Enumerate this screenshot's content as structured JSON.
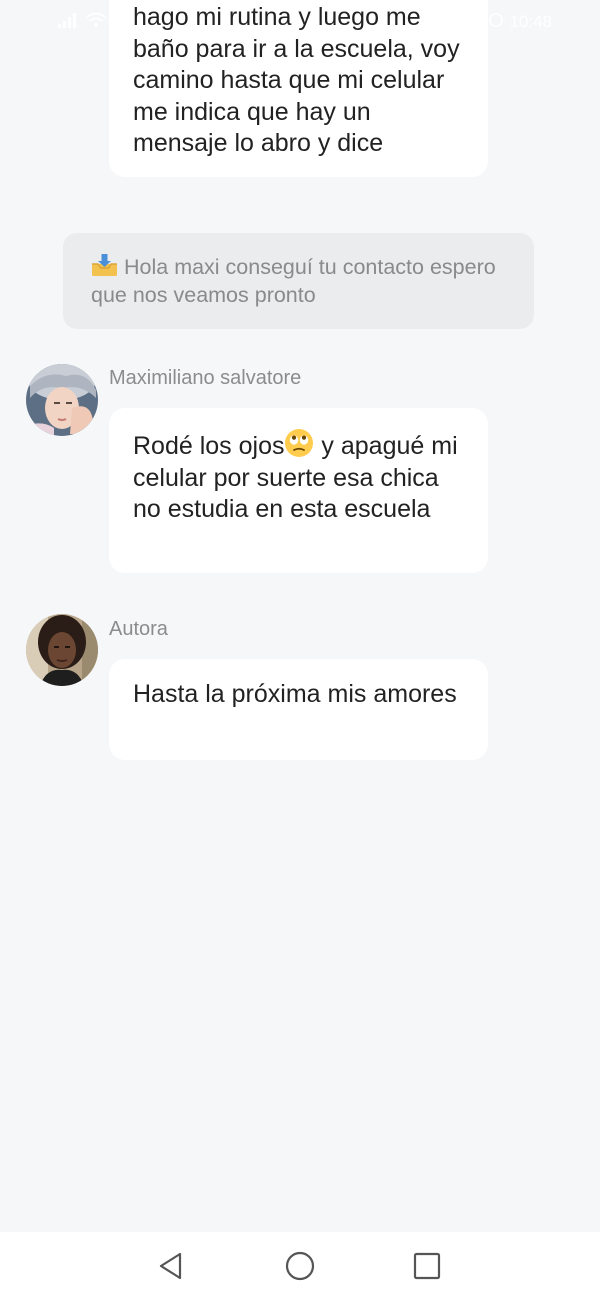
{
  "status_bar": {
    "time": "10:48"
  },
  "messages": [
    {
      "text": "hago mi rutina y luego me baño para ir a la escuela, voy camino hasta que mi celular me indica que hay un mensaje lo abro y dice"
    },
    {
      "type": "notice",
      "icon": "inbox-download-icon",
      "text": "Hola maxi conseguí tu contacto espero que nos veamos pronto"
    },
    {
      "sender": "Maximiliano salvatore",
      "text_before_emoji": "Rodé los ojos",
      "emoji": "eye-roll-emoji",
      "text_after_emoji": " y apagué mi celular por suerte esa chica no estudia en esta escuela"
    },
    {
      "sender": "Autora",
      "text": "Hasta la próxima mis amores"
    }
  ],
  "nav_bar": {
    "buttons": [
      "back-icon",
      "home-icon",
      "recents-icon"
    ]
  },
  "colors": {
    "background": "#f6f7f9",
    "bubble": "#ffffff",
    "notice": "#ebecee",
    "sender_text": "#8c8c8c"
  }
}
